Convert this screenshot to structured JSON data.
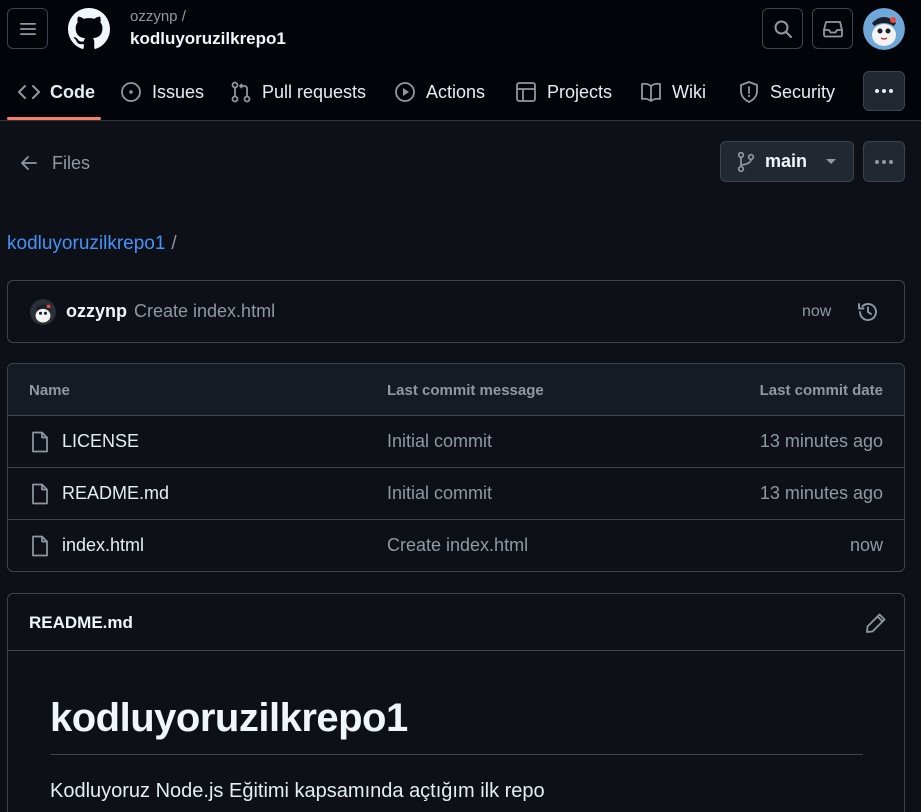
{
  "header": {
    "owner": "ozzynp /",
    "repo": "kodluyoruzilkrepo1"
  },
  "tabs": [
    {
      "label": "Code",
      "icon": "code-icon"
    },
    {
      "label": "Issues",
      "icon": "issue-opened-icon"
    },
    {
      "label": "Pull requests",
      "icon": "git-pull-request-icon"
    },
    {
      "label": "Actions",
      "icon": "play-icon"
    },
    {
      "label": "Projects",
      "icon": "table-icon"
    },
    {
      "label": "Wiki",
      "icon": "book-icon"
    },
    {
      "label": "Security",
      "icon": "shield-icon"
    }
  ],
  "files_bar": {
    "back_label": "Files",
    "branch": "main"
  },
  "path": {
    "repo_link": "kodluyoruzilkrepo1",
    "separator": "/"
  },
  "latest_commit": {
    "author": "ozzynp",
    "message": "Create index.html",
    "time": "now"
  },
  "file_table": {
    "columns": [
      "Name",
      "Last commit message",
      "Last commit date"
    ],
    "rows": [
      {
        "name": "LICENSE",
        "message": "Initial commit",
        "date": "13 minutes ago"
      },
      {
        "name": "README.md",
        "message": "Initial commit",
        "date": "13 minutes ago"
      },
      {
        "name": "index.html",
        "message": "Create index.html",
        "date": "now"
      }
    ]
  },
  "readme": {
    "file_name": "README.md",
    "heading": "kodluyoruzilkrepo1",
    "paragraph": "Kodluyoruz Node.js Eğitimi kapsamında açtığım ilk repo"
  },
  "colors": {
    "background": "#0d1117",
    "header_bg": "#010409",
    "border": "#3d444d",
    "link": "#4493f8",
    "active_tab_underline": "#f78166",
    "muted_text": "#9198a1"
  }
}
